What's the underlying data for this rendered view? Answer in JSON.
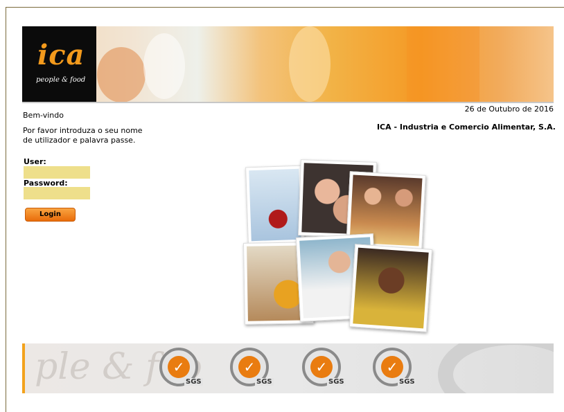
{
  "header": {
    "logo_main": "ica",
    "logo_sub": "people & food"
  },
  "left": {
    "welcome": "Bem-vindo",
    "intro": "Por favor introduza o seu nome de utilizador e palavra passe."
  },
  "right": {
    "date": "26 de Outubro de 2016",
    "company": "ICA - Industria e Comercio Alimentar, S.A."
  },
  "form": {
    "user_label": "User:",
    "user_value": "",
    "password_label": "Password:",
    "password_value": "",
    "login_label": "Login"
  },
  "footer": {
    "watermark": "ple & foo",
    "seals": [
      {
        "mark": "✓",
        "label": "SGS"
      },
      {
        "mark": "✓",
        "label": "SGS"
      },
      {
        "mark": "✓",
        "label": "SGS"
      },
      {
        "mark": "✓",
        "label": "SGS"
      }
    ]
  },
  "colors": {
    "accent": "#f39a1c",
    "input_bg": "#eedf8b",
    "button": "#e96c0a"
  }
}
